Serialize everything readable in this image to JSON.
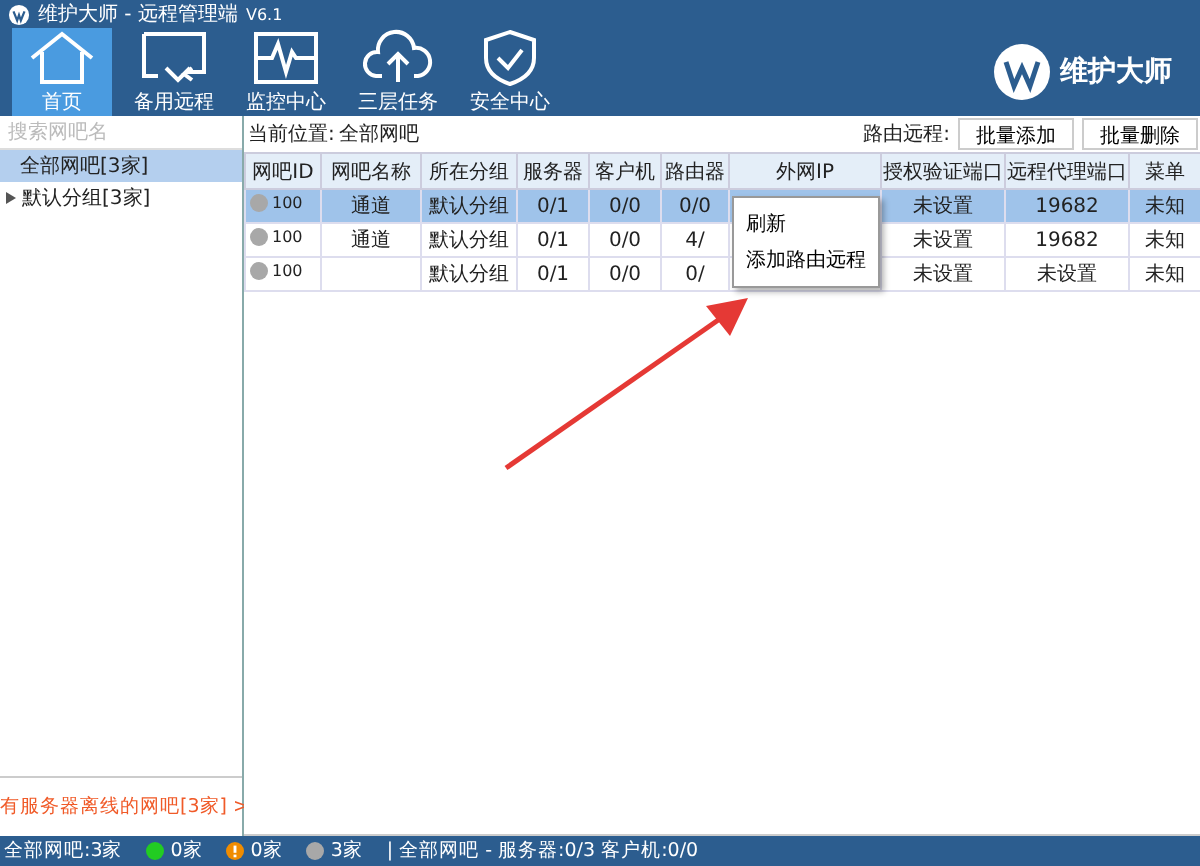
{
  "window": {
    "title": "维护大师 - 远程管理端",
    "version": "V6.1"
  },
  "toolbar": [
    {
      "label": "首页",
      "selected": true
    },
    {
      "label": "备用远程",
      "selected": false
    },
    {
      "label": "监控中心",
      "selected": false
    },
    {
      "label": "三层任务",
      "selected": false
    },
    {
      "label": "安全中心",
      "selected": false
    }
  ],
  "brand": "维护大师",
  "sidebar": {
    "search": {
      "placeholder": "搜索网吧名"
    },
    "items": [
      {
        "label": "全部网吧[3家]",
        "selected": true
      },
      {
        "label": "默认分组[3家]",
        "selected": false,
        "expanded": false
      }
    ],
    "offline_link": "有服务器离线的网吧[3家] >"
  },
  "location": {
    "label": "当前位置:",
    "value": "全部网吧"
  },
  "router_remote": {
    "label": "路由远程:",
    "buttons": [
      "批量添加",
      "批量删除"
    ]
  },
  "table": {
    "columns": [
      "网吧ID",
      "网吧名称",
      "所在分组",
      "服务器",
      "客户机",
      "路由器",
      "外网IP",
      "授权验证端口",
      "远程代理端口",
      "菜单"
    ],
    "rows": [
      {
        "selected": true,
        "color": "#a8a8a8",
        "cells": [
          "100",
          "通道",
          "默认分组",
          "0/1",
          "0/0",
          "0/0",
          "",
          "未设置",
          "19682",
          "未知"
        ]
      },
      {
        "selected": false,
        "color": "#a8a8a8",
        "cells": [
          "100",
          "通道",
          "默认分组",
          "0/1",
          "0/0",
          "4/",
          "",
          "未设置",
          "19682",
          "未知"
        ]
      },
      {
        "selected": false,
        "color": "#a8a8a8",
        "cells": [
          "100",
          "",
          "默认分组",
          "0/1",
          "0/0",
          "0/",
          "",
          "未设置",
          "未设置",
          "未知"
        ]
      }
    ]
  },
  "context_menu": [
    "刷新",
    "添加路由远程"
  ],
  "status_bar": {
    "total": "全部网吧:3家",
    "counts": [
      {
        "kind": "dot",
        "color": "#22cc22",
        "text": "0家"
      },
      {
        "kind": "warning",
        "color": "#f08c00",
        "text": "0家"
      },
      {
        "kind": "dot",
        "color": "#a8a8a8",
        "text": "3家"
      }
    ],
    "separator": "|",
    "summary": "全部网吧 - 服务器:0/3 客户机:0/0"
  }
}
